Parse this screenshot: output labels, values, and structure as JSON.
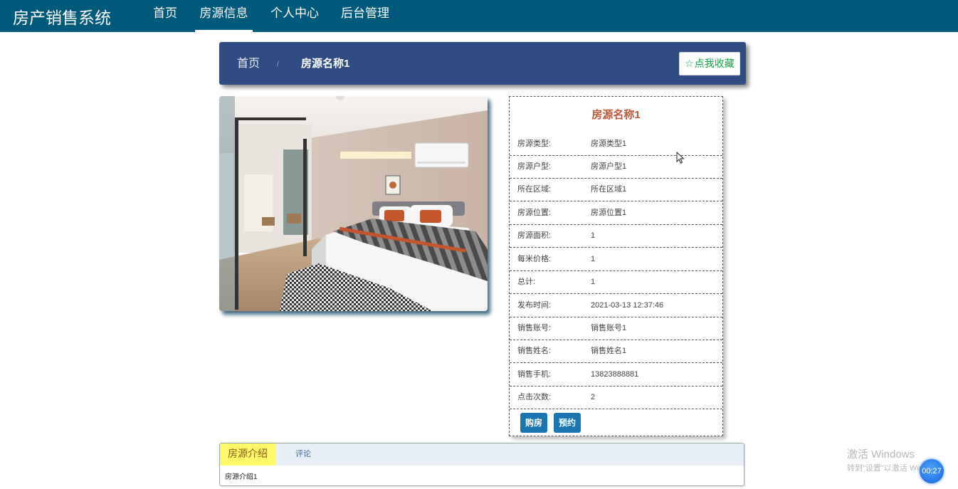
{
  "brand": "房产销售系统",
  "nav": [
    {
      "label": "首页"
    },
    {
      "label": "房源信息"
    },
    {
      "label": "个人中心"
    },
    {
      "label": "后台管理"
    }
  ],
  "breadcrumb": {
    "home": "首页",
    "separator": "/",
    "current": "房源名称1"
  },
  "favorite_button": "点我收藏",
  "details": {
    "title": "房源名称1",
    "rows": [
      {
        "label": "房源类型:",
        "value": "房源类型1"
      },
      {
        "label": "房源户型:",
        "value": "房源户型1"
      },
      {
        "label": "所在区域:",
        "value": "所在区域1"
      },
      {
        "label": "房源位置:",
        "value": "房源位置1"
      },
      {
        "label": "房源面积:",
        "value": "1"
      },
      {
        "label": "每米价格:",
        "value": "1"
      },
      {
        "label": "总计:",
        "value": "1"
      },
      {
        "label": "发布时间:",
        "value": "2021-03-13 12:37:46"
      },
      {
        "label": "销售账号:",
        "value": "销售账号1"
      },
      {
        "label": "销售姓名:",
        "value": "销售姓名1"
      },
      {
        "label": "销售手机:",
        "value": "13823888881"
      },
      {
        "label": "点击次数:",
        "value": "2"
      }
    ],
    "buy_button": "购房",
    "reserve_button": "预约"
  },
  "tabs": {
    "intro_tab": "房源介绍",
    "comment_tab": "评论",
    "intro_content": "房源介绍1"
  },
  "watermark": {
    "line1": "激活 Windows",
    "line2": "转到\"设置\"以激活 Windows。"
  },
  "timer": "00:27",
  "colors": {
    "nav_bg": "#005a7c",
    "breadcrumb_bg": "#2f4d82",
    "title_color": "#c0563a",
    "button_bg": "#1976b1",
    "favorite_text": "#1aa34a",
    "active_tab_bg": "#fff96a"
  },
  "icons": {
    "favorite": "star-outline-icon",
    "cursor": "mouse-cursor-icon"
  }
}
